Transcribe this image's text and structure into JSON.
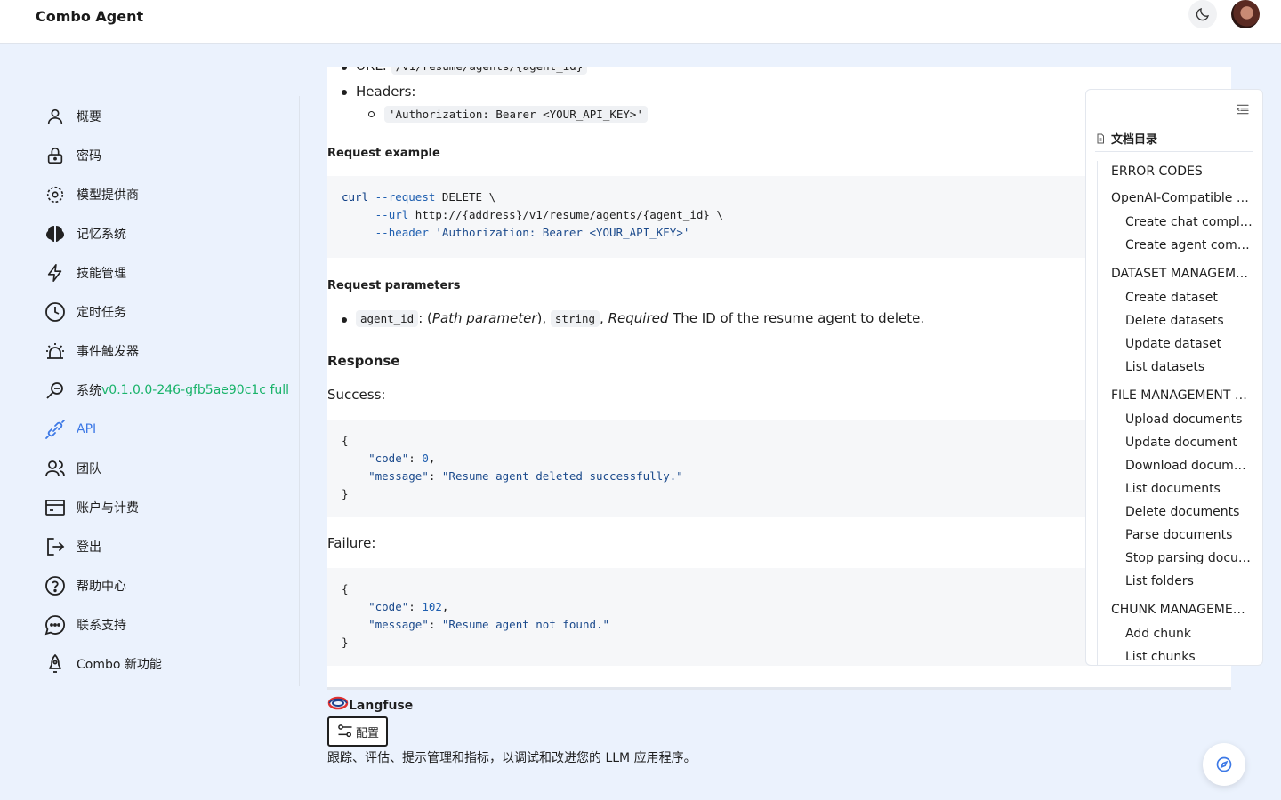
{
  "header": {
    "brand": "Combo Agent",
    "theme_icon": "moon-icon",
    "avatar": "user-avatar"
  },
  "sidebar": {
    "items": [
      {
        "label": "概要",
        "icon": "user-icon"
      },
      {
        "label": "密码",
        "icon": "lock-icon"
      },
      {
        "label": "模型提供商",
        "icon": "model-provider-icon"
      },
      {
        "label": "记忆系统",
        "icon": "brain-icon"
      },
      {
        "label": "技能管理",
        "icon": "lightning-icon"
      },
      {
        "label": "定时任务",
        "icon": "clock-icon"
      },
      {
        "label": "事件触发器",
        "icon": "alarm-icon"
      },
      {
        "label": "系统",
        "version": "v0.1.0.0-246-gfb5ae90c1c full",
        "icon": "search-icon"
      },
      {
        "label": "API",
        "icon": "api-link-icon",
        "active": true
      },
      {
        "label": "团队",
        "icon": "team-icon"
      },
      {
        "label": "账户与计费",
        "icon": "card-icon"
      },
      {
        "label": "登出",
        "icon": "logout-icon"
      },
      {
        "label": "帮助中心",
        "icon": "help-icon"
      },
      {
        "label": "联系支持",
        "icon": "chat-icon"
      },
      {
        "label": "Combo 新功能",
        "icon": "rocket-icon"
      }
    ],
    "accent": "#3d79e6"
  },
  "doc": {
    "url_label": "URL:",
    "url_value": "/v1/resume/agents/{agent_id}",
    "headers_label": "Headers:",
    "header_value": "'Authorization: Bearer <YOUR_API_KEY>'",
    "request_example_title": "Request example",
    "curl": {
      "l1_cmd": "curl",
      "l1_flag": "--request",
      "l1_rest": " DELETE \\",
      "l2_flag": "--url",
      "l2_rest": " http://{address}/v1/resume/agents/{agent_id} \\",
      "l3_flag": "--header",
      "l3_str": "'Authorization: Bearer <YOUR_API_KEY>'"
    },
    "request_params_title": "Request parameters",
    "param_name": "agent_id",
    "param_kind": "Path parameter",
    "param_type": "string",
    "param_required": "Required",
    "param_desc": "The ID of the resume agent to delete.",
    "response_title": "Response",
    "success_label": "Success:",
    "success_code": "0",
    "success_message": "\"Resume agent deleted successfully.\"",
    "failure_label": "Failure:",
    "failure_code": "102",
    "failure_message": "\"Resume agent not found.\"",
    "key_code": "\"code\"",
    "key_message": "\"message\""
  },
  "toc": {
    "title": "文档目录",
    "items": [
      {
        "label": "ERROR CODES",
        "level": 1
      },
      {
        "label": "OpenAI-Compatible API",
        "level": 1
      },
      {
        "label": "Create chat completion",
        "level": 2
      },
      {
        "label": "Create agent completion",
        "level": 2
      },
      {
        "label": "DATASET MANAGEMENT",
        "level": 1
      },
      {
        "label": "Create dataset",
        "level": 2
      },
      {
        "label": "Delete datasets",
        "level": 2
      },
      {
        "label": "Update dataset",
        "level": 2
      },
      {
        "label": "List datasets",
        "level": 2
      },
      {
        "label": "FILE MANAGEMENT WITHIN DATASET",
        "level": 1
      },
      {
        "label": "Upload documents",
        "level": 2
      },
      {
        "label": "Update document",
        "level": 2
      },
      {
        "label": "Download document",
        "level": 2
      },
      {
        "label": "List documents",
        "level": 2
      },
      {
        "label": "Delete documents",
        "level": 2
      },
      {
        "label": "Parse documents",
        "level": 2
      },
      {
        "label": "Stop parsing documents",
        "level": 2
      },
      {
        "label": "List folders",
        "level": 2
      },
      {
        "label": "CHUNK MANAGEMENT WITHIN DATASET",
        "level": 1
      },
      {
        "label": "Add chunk",
        "level": 2
      },
      {
        "label": "List chunks",
        "level": 2
      }
    ]
  },
  "langfuse": {
    "name": "Langfuse",
    "config_label": "配置",
    "description": "跟踪、评估、提示管理和指标，以调试和改进您的 LLM 应用程序。"
  }
}
